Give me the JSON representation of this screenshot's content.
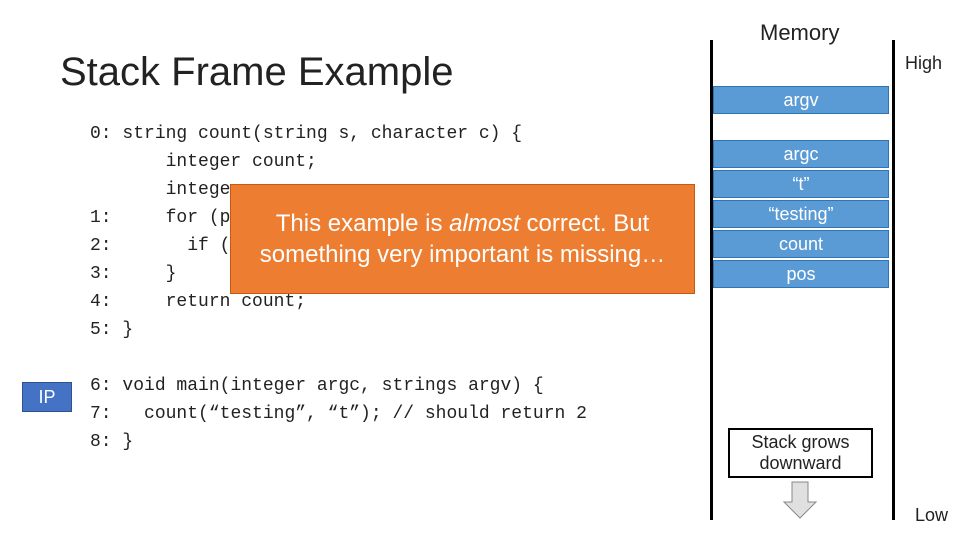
{
  "title": "Stack Frame Example",
  "memory_title": "Memory",
  "high_label": "High",
  "low_label": "Low",
  "ip_label": "IP",
  "callout_html": "This example is <em>almost</em> correct. But something very important is missing…",
  "growth_text": "Stack grows downward",
  "code": {
    "l0n": "0:",
    "l0c": "string count(string s, character c) {",
    "l1a": "    integer count;",
    "l1b": "    integer pos;",
    "l1n": "1:",
    "l1c": "    for (pos = 0; pos < length(s); pos++) {",
    "l2n": "2:",
    "l2c": "      if (s[pos] == c) count++;",
    "l3n": "3:",
    "l3c": "    }",
    "l4n": "4:",
    "l4c": "    return count;",
    "l5n": "5:",
    "l5c": "}",
    "l6n": "6:",
    "l6c": "void main(integer argc, strings argv) {",
    "l7n": "7:",
    "l7c": "  count(“testing”, “t”); // should return 2",
    "l8n": "8:",
    "l8c": "}"
  },
  "stack": {
    "c0": "argv",
    "c1": "argc",
    "c2": "“t”",
    "c3": "“testing”",
    "c4": "count",
    "c5": "pos"
  }
}
